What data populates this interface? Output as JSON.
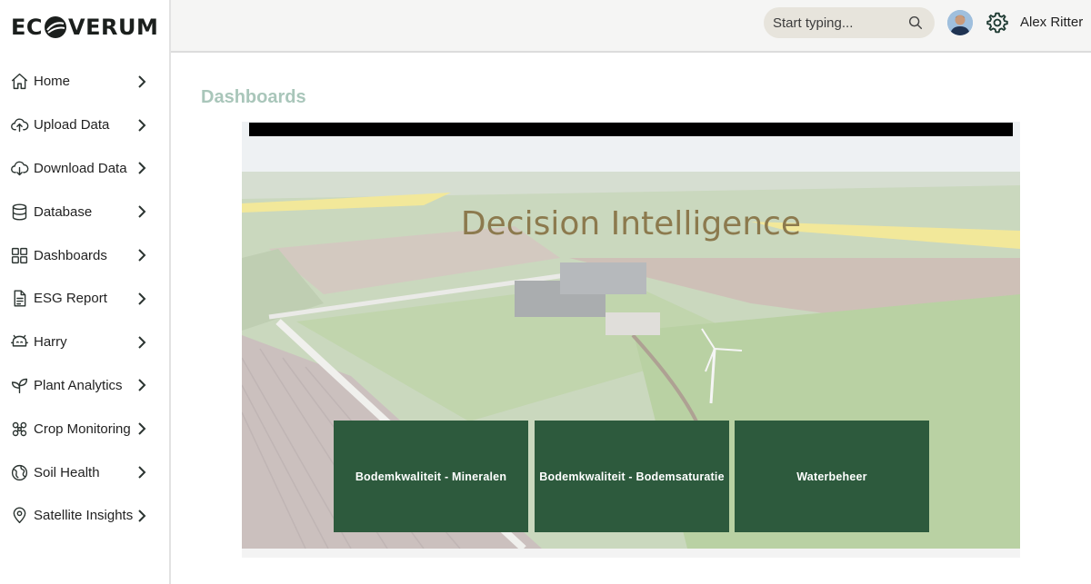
{
  "app": {
    "brand": "ECOVERUM"
  },
  "sidebar": {
    "items": [
      {
        "label": "Home",
        "icon": "home-icon"
      },
      {
        "label": "Upload Data",
        "icon": "cloud-upload-icon"
      },
      {
        "label": "Download Data",
        "icon": "cloud-download-icon"
      },
      {
        "label": "Database",
        "icon": "database-icon"
      },
      {
        "label": "Dashboards",
        "icon": "grid-icon"
      },
      {
        "label": "ESG Report",
        "icon": "document-icon"
      },
      {
        "label": "Harry",
        "icon": "robot-icon"
      },
      {
        "label": "Plant Analytics",
        "icon": "leaf-icon"
      },
      {
        "label": "Crop Monitoring",
        "icon": "crop-icon"
      },
      {
        "label": "Soil Health",
        "icon": "globe-icon"
      },
      {
        "label": "Satellite Insights",
        "icon": "map-pin-icon"
      }
    ]
  },
  "header": {
    "search_placeholder": "Start typing...",
    "user_name": "Alex Ritter"
  },
  "main": {
    "title": "Dashboards",
    "report": {
      "heading": "Decision Intelligence",
      "tiles": [
        {
          "label": "Bodemkwaliteit - Mineralen"
        },
        {
          "label": "Bodemkwaliteit - Bodemsaturatie"
        },
        {
          "label": "Waterbeheer"
        }
      ]
    }
  },
  "colors": {
    "tile": "#2d5a3d",
    "page_title": "#a9c6ba",
    "heading": "#8c7a4e",
    "search_bg": "#e7e4dc"
  }
}
